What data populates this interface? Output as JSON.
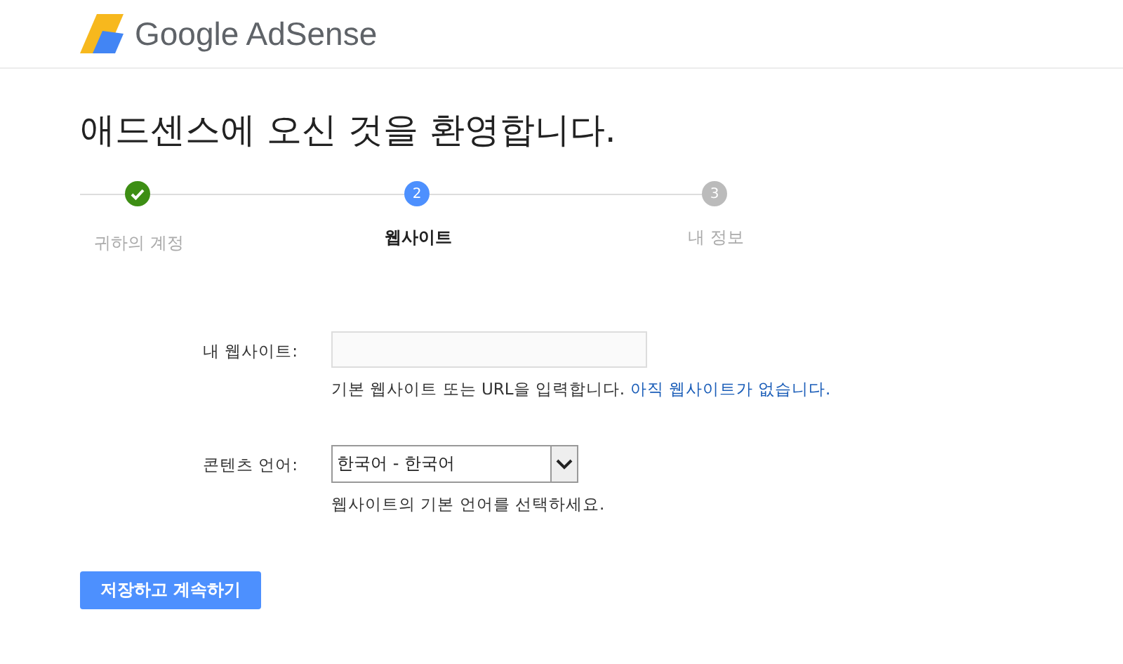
{
  "header": {
    "logo_text": "Google AdSense"
  },
  "title": "애드센스에 오신 것을 환영합니다.",
  "steps": [
    {
      "label": "귀하의 계정",
      "completed": true,
      "selected": false
    },
    {
      "label": "웹사이트",
      "number": "2",
      "completed": false,
      "selected": true
    },
    {
      "label": "내 정보",
      "number": "3",
      "completed": false,
      "selected": false
    }
  ],
  "form": {
    "website": {
      "label": "내 웹사이트:",
      "help": "기본 웹사이트 또는 URL을 입력합니다.",
      "link": "아직 웹사이트가 없습니다."
    },
    "language": {
      "label": "콘텐츠 언어:",
      "value": "한국어 - 한국어",
      "help": "웹사이트의 기본 언어를 선택하세요."
    }
  },
  "button": "저장하고 계속하기"
}
